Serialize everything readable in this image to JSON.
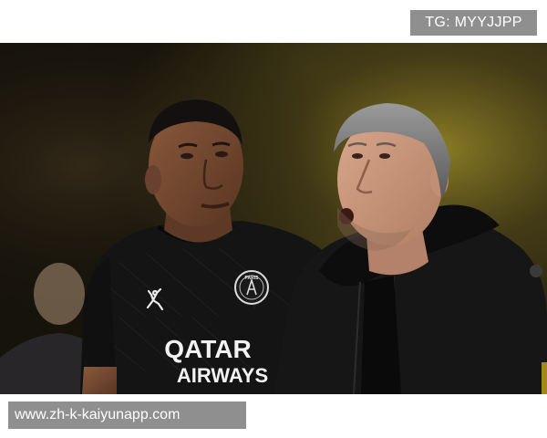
{
  "watermark_top": "TG: MYYJJPP",
  "watermark_bottom": "www.zh-k-kaiyunapp.com",
  "photo": {
    "description_icons": [
      "jordan-logo-icon",
      "club-crest-icon"
    ],
    "jersey_sponsor_line1": "QATAR",
    "jersey_sponsor_line2": "AIRWAYS",
    "crest_text": "PARIS"
  },
  "colors": {
    "watermark_bg": "#8f8f8f",
    "background_dark": "#1e1a10",
    "stadium_light": "#c8b33a",
    "jersey": "#141414"
  }
}
